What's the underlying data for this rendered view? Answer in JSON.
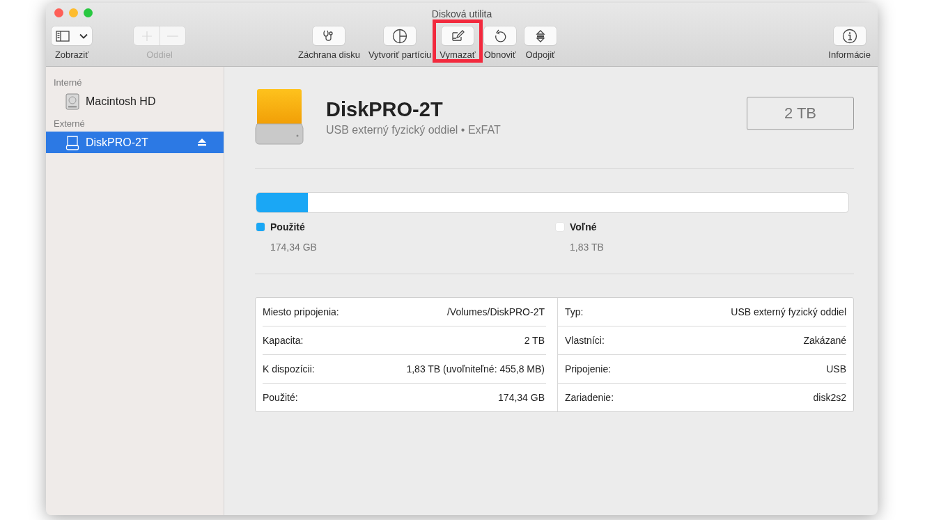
{
  "window": {
    "title": "Disková utilita"
  },
  "toolbar": {
    "items": [
      {
        "label": "Zobraziť",
        "kind": "view",
        "disabled": false,
        "highlighted": false
      },
      {
        "label": "Oddiel",
        "kind": "addremove",
        "disabled": true,
        "highlighted": false
      },
      {
        "label": "Záchrana disku",
        "kind": "rescue",
        "disabled": false,
        "highlighted": false
      },
      {
        "label": "Vytvoriť partíciu",
        "kind": "partition",
        "disabled": false,
        "highlighted": false
      },
      {
        "label": "Vymazať",
        "kind": "erase",
        "disabled": false,
        "highlighted": true
      },
      {
        "label": "Obnoviť",
        "kind": "restore",
        "disabled": false,
        "highlighted": false
      },
      {
        "label": "Odpojiť",
        "kind": "unmount",
        "disabled": false,
        "highlighted": false
      },
      {
        "label": "Informácie",
        "kind": "info",
        "disabled": false,
        "highlighted": false
      }
    ]
  },
  "sidebar": {
    "sections": [
      {
        "heading": "Interné",
        "items": [
          {
            "label": "Macintosh HD",
            "kind": "internal",
            "selected": false,
            "ejectable": false
          }
        ]
      },
      {
        "heading": "Externé",
        "items": [
          {
            "label": "DiskPRO-2T",
            "kind": "external",
            "selected": true,
            "ejectable": true
          }
        ]
      }
    ]
  },
  "volume": {
    "name": "DiskPRO-2T",
    "subtitle": "USB externý fyzický oddiel • ExFAT",
    "size": "2 TB"
  },
  "usage": {
    "level": 0.087,
    "legend": [
      {
        "label": "Použité",
        "value": "174,34 GB",
        "color": "#1aa7f5"
      },
      {
        "label": "Voľné",
        "value": "1,83 TB",
        "color": "#ffffff"
      }
    ]
  },
  "details": {
    "rows": [
      [
        {
          "label": "Miesto pripojenia:",
          "value": "/Volumes/DiskPRO-2T"
        },
        {
          "label": "Typ:",
          "value": "USB externý fyzický oddiel"
        }
      ],
      [
        {
          "label": "Kapacita:",
          "value": "2 TB"
        },
        {
          "label": "Vlastníci:",
          "value": "Zakázané"
        }
      ],
      [
        {
          "label": "K dispozícii:",
          "value": "1,83 TB (uvoľniteľné: 455,8 MB)"
        },
        {
          "label": "Pripojenie:",
          "value": "USB"
        }
      ],
      [
        {
          "label": "Použité:",
          "value": "174,34 GB"
        },
        {
          "label": "Zariadenie:",
          "value": "disk2s2"
        }
      ]
    ]
  }
}
